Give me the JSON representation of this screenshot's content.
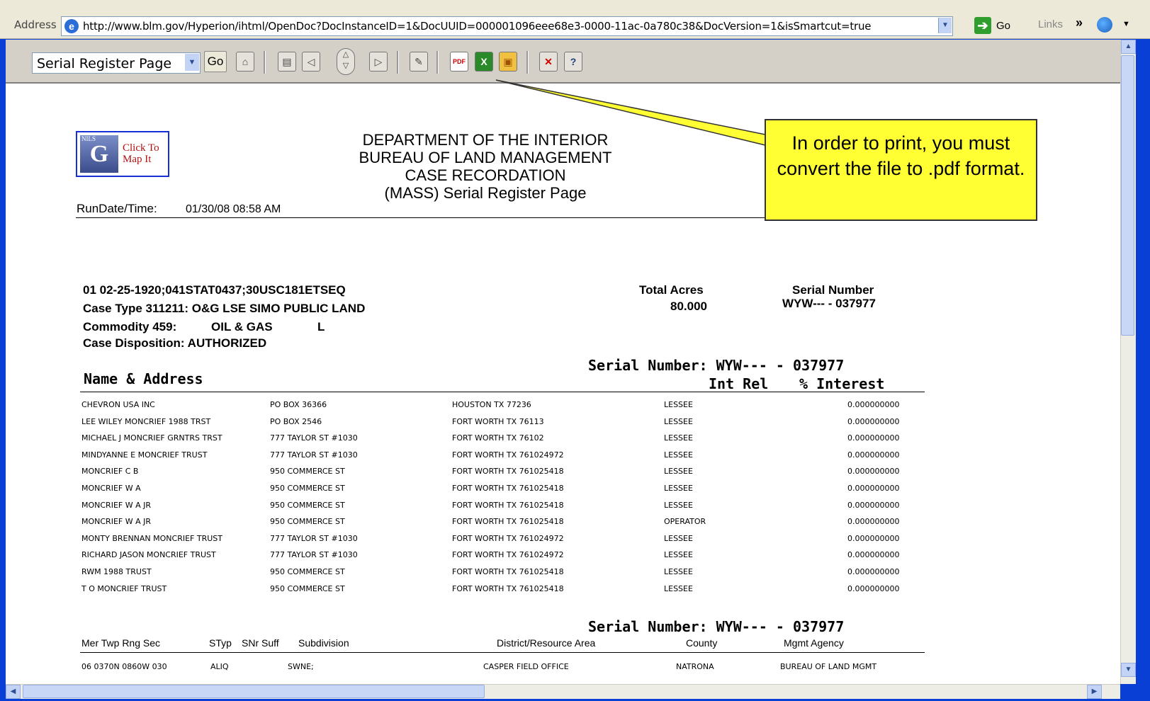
{
  "browser": {
    "address_label": "Address",
    "url": "http://www.blm.gov/Hyperion/ihtml/OpenDoc?DocInstanceID=1&DocUUID=000001096eee68e3-0000-11ac-0a780c38&DocVersion=1&isSmartcut=true",
    "go_label": "Go",
    "links_label": "Links",
    "links_chevron": "»"
  },
  "toolbar": {
    "section_select": "Serial Register Page",
    "go_button": "Go"
  },
  "header": {
    "map_logo_small": "NILS",
    "map_logo_text": "Click To Map It",
    "line1": "DEPARTMENT OF THE INTERIOR",
    "line2": "BUREAU OF LAND MANAGEMENT",
    "line3": "CASE RECORDATION",
    "line4": "(MASS) Serial Register Page",
    "rundate_label": "RunDate/Time:",
    "rundate_value": "01/30/08 08:58 AM"
  },
  "case": {
    "act": "01 02-25-1920;041STAT0437;30USC181ETSEQ",
    "case_type": "Case Type  311211: O&G LSE SIMO PUBLIC LAND",
    "commodity_label": "Commodity 459:",
    "commodity_value": "OIL & GAS",
    "commodity_flag": "L",
    "disposition": "Case Disposition: AUTHORIZED",
    "total_acres_label": "Total Acres",
    "total_acres_value": "80.000",
    "serial_label": "Serial Number",
    "serial_value": "WYW--- - 037977"
  },
  "names_section": {
    "serial_heading": "Serial Number: WYW--- - 037977",
    "name_address_heading": "Name & Address",
    "int_rel_heading": "Int Rel",
    "pct_heading": "% Interest",
    "rows": [
      {
        "name": "CHEVRON USA INC",
        "address": "PO BOX 36366",
        "city": "HOUSTON TX 77236",
        "rel": "LESSEE",
        "pct": "0.000000000"
      },
      {
        "name": "LEE WILEY MONCRIEF 1988 TRST",
        "address": "PO BOX 2546",
        "city": "FORT WORTH TX 76113",
        "rel": "LESSEE",
        "pct": "0.000000000"
      },
      {
        "name": "MICHAEL J MONCRIEF GRNTRS TRST",
        "address": "777 TAYLOR ST #1030",
        "city": "FORT WORTH TX 76102",
        "rel": "LESSEE",
        "pct": "0.000000000"
      },
      {
        "name": "MINDYANNE E MONCRIEF TRUST",
        "address": "777 TAYLOR ST #1030",
        "city": "FORT WORTH TX 761024972",
        "rel": "LESSEE",
        "pct": "0.000000000"
      },
      {
        "name": "MONCRIEF C B",
        "address": "950 COMMERCE ST",
        "city": "FORT WORTH TX 761025418",
        "rel": "LESSEE",
        "pct": "0.000000000"
      },
      {
        "name": "MONCRIEF W A",
        "address": "950 COMMERCE ST",
        "city": "FORT WORTH TX 761025418",
        "rel": "LESSEE",
        "pct": "0.000000000"
      },
      {
        "name": "MONCRIEF W A JR",
        "address": "950 COMMERCE ST",
        "city": "FORT WORTH TX 761025418",
        "rel": "LESSEE",
        "pct": "0.000000000"
      },
      {
        "name": "MONCRIEF W A JR",
        "address": "950 COMMERCE ST",
        "city": "FORT WORTH TX 761025418",
        "rel": "OPERATOR",
        "pct": "0.000000000"
      },
      {
        "name": "MONTY BRENNAN MONCRIEF TRUST",
        "address": "777 TAYLOR ST #1030",
        "city": "FORT WORTH TX 761024972",
        "rel": "LESSEE",
        "pct": "0.000000000"
      },
      {
        "name": "RICHARD JASON MONCRIEF TRUST",
        "address": "777 TAYLOR ST #1030",
        "city": "FORT WORTH TX 761024972",
        "rel": "LESSEE",
        "pct": "0.000000000"
      },
      {
        "name": "RWM 1988 TRUST",
        "address": "950 COMMERCE ST",
        "city": "FORT WORTH TX 761025418",
        "rel": "LESSEE",
        "pct": "0.000000000"
      },
      {
        "name": "T O MONCRIEF TRUST",
        "address": "950 COMMERCE ST",
        "city": "FORT WORTH TX 761025418",
        "rel": "LESSEE",
        "pct": "0.000000000"
      }
    ]
  },
  "land_section": {
    "serial_heading": "Serial Number: WYW--- - 037977",
    "col_mer": "Mer Twp  Rng   Sec",
    "col_styp": "STyp",
    "col_snr": "SNr Suff",
    "col_subdivision": "Subdivision",
    "col_district": "District/Resource Area",
    "col_county": "County",
    "col_agency": "Mgmt Agency",
    "row": {
      "mer": "06 0370N 0860W 030",
      "styp": "ALIQ",
      "subdivision": "SWNE;",
      "district": "CASPER FIELD OFFICE",
      "county": "NATRONA",
      "agency": "BUREAU OF LAND MGMT"
    }
  },
  "callout": {
    "text": "In order to print, you must convert the file to .pdf format."
  },
  "colors": {
    "callout_fill": "#ffff33",
    "window_frame": "#0a3fd6",
    "toolbar_bg": "#d4d0c8"
  }
}
